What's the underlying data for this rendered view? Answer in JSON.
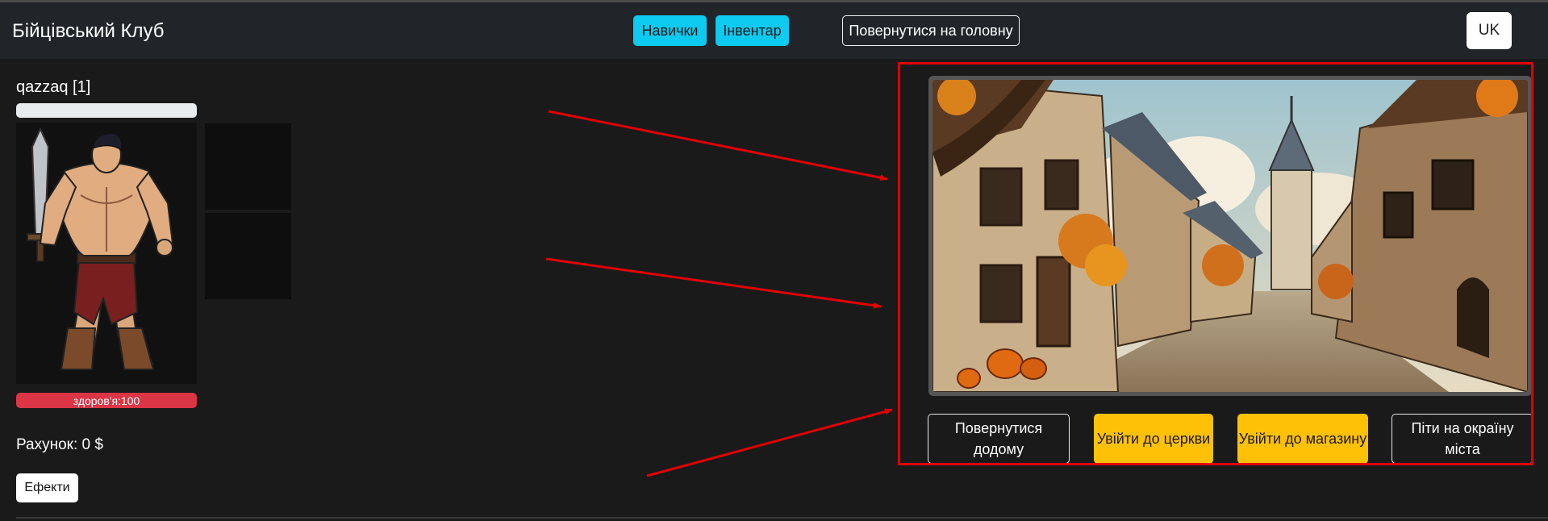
{
  "header": {
    "brand": "Бійцівський Клуб",
    "skills_label": "Навички",
    "inventory_label": "Інвентар",
    "home_label": "Повернутися на головну",
    "lang_label": "UK"
  },
  "player": {
    "name": "qazzaq [1]",
    "xp_fraction": 0,
    "hp_label": "здоров'я:100",
    "balance": "Рахунок: 0 $",
    "effects_label": "Ефекти"
  },
  "scene": {
    "actions": [
      {
        "label": "Повернутися додому",
        "style": "outline"
      },
      {
        "label": "Увійти до церкви",
        "style": "warning"
      },
      {
        "label": "Увійти до магазину",
        "style": "warning"
      },
      {
        "label": "Піти на окраїну міста",
        "style": "outline"
      }
    ]
  },
  "colors": {
    "navbar": "#212529",
    "info": "#0dcaf0",
    "warning": "#ffc107",
    "danger": "#dc3545",
    "annotation": "#e00000"
  }
}
